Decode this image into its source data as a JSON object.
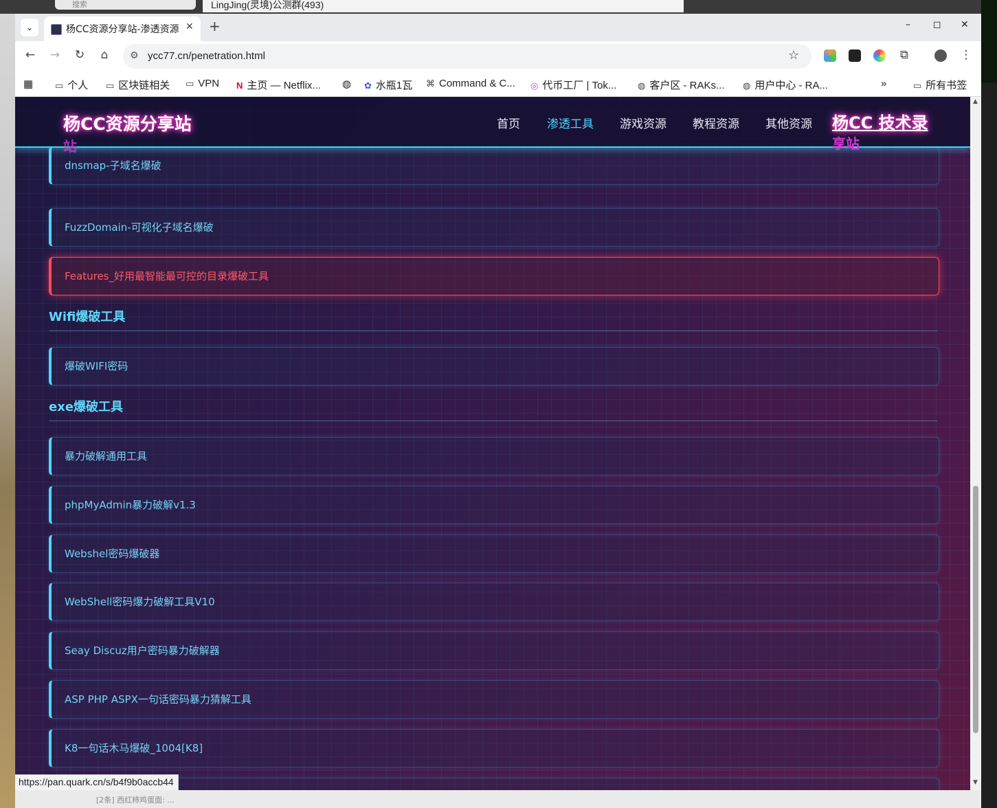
{
  "desktop": {
    "search_placeholder": "搜索",
    "chat_title": "LingJing(灵境)公测群(493)",
    "bottom_snippet": "[2条] 西红柿鸡蛋面: ..."
  },
  "browser": {
    "tab_title": "杨CC资源分享站-渗透资源",
    "url": "ycc77.cn/penetration.html",
    "bookmarks": [
      "个人",
      "区块链相关",
      "VPN",
      "主页 — Netflix...",
      "水瓶1瓦",
      "Command & C...",
      "代币工厂 | Tok...",
      "客户区 - RAKs...",
      "用户中心 - RA..."
    ],
    "all_bookmarks": "所有书签",
    "status_url": "https://pan.quark.cn/s/b4f9b0accb44"
  },
  "site": {
    "logo": "杨CC资源分享站",
    "logo_ghost": "站",
    "nav": [
      "首页",
      "渗透工具",
      "游戏资源",
      "教程资源",
      "其他资源"
    ],
    "nav_active": "渗透工具",
    "brand": "杨CC 技术录",
    "brand_ghost": "享站"
  },
  "content": {
    "group1_items": [
      "dnsmap-子域名爆破",
      "FuzzDomain-可视化子域名爆破",
      "Features_好用最智能最可控的目录爆破工具"
    ],
    "sections": [
      {
        "title": "Wifi爆破工具",
        "items": [
          "爆破WIFI密码"
        ]
      },
      {
        "title": "exe爆破工具",
        "items": [
          "暴力破解通用工具",
          "phpMyAdmin暴力破解v1.3",
          "Webshel密码爆破器",
          "WebShell密码爆力破解工具V10",
          "Seay Discuz用户密码暴力破解器",
          "ASP PHP ASPX一句话密码暴力猜解工具",
          "K8一句话木马爆破_1004[K8]"
        ]
      }
    ]
  },
  "colors": {
    "accent_cyan": "#4fd6f7",
    "hover_red": "#ff4b5c",
    "glow_pink": "#ff3ccf"
  }
}
